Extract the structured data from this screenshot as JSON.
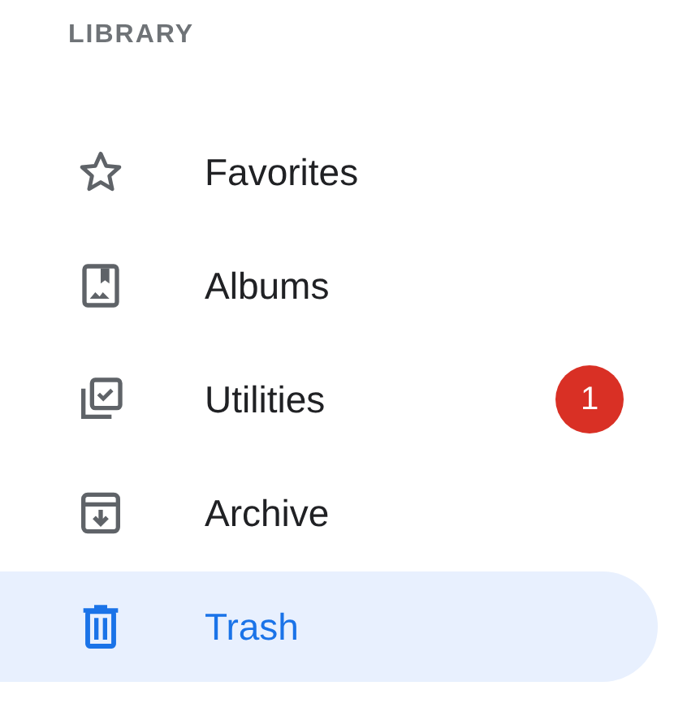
{
  "section": {
    "title": "LIBRARY"
  },
  "items": [
    {
      "kind": "favorites",
      "label": "Favorites",
      "selected": false
    },
    {
      "kind": "albums",
      "label": "Albums",
      "selected": false
    },
    {
      "kind": "utilities",
      "label": "Utilities",
      "selected": false,
      "badge": "1"
    },
    {
      "kind": "archive",
      "label": "Archive",
      "selected": false
    },
    {
      "kind": "trash",
      "label": "Trash",
      "selected": true
    }
  ]
}
